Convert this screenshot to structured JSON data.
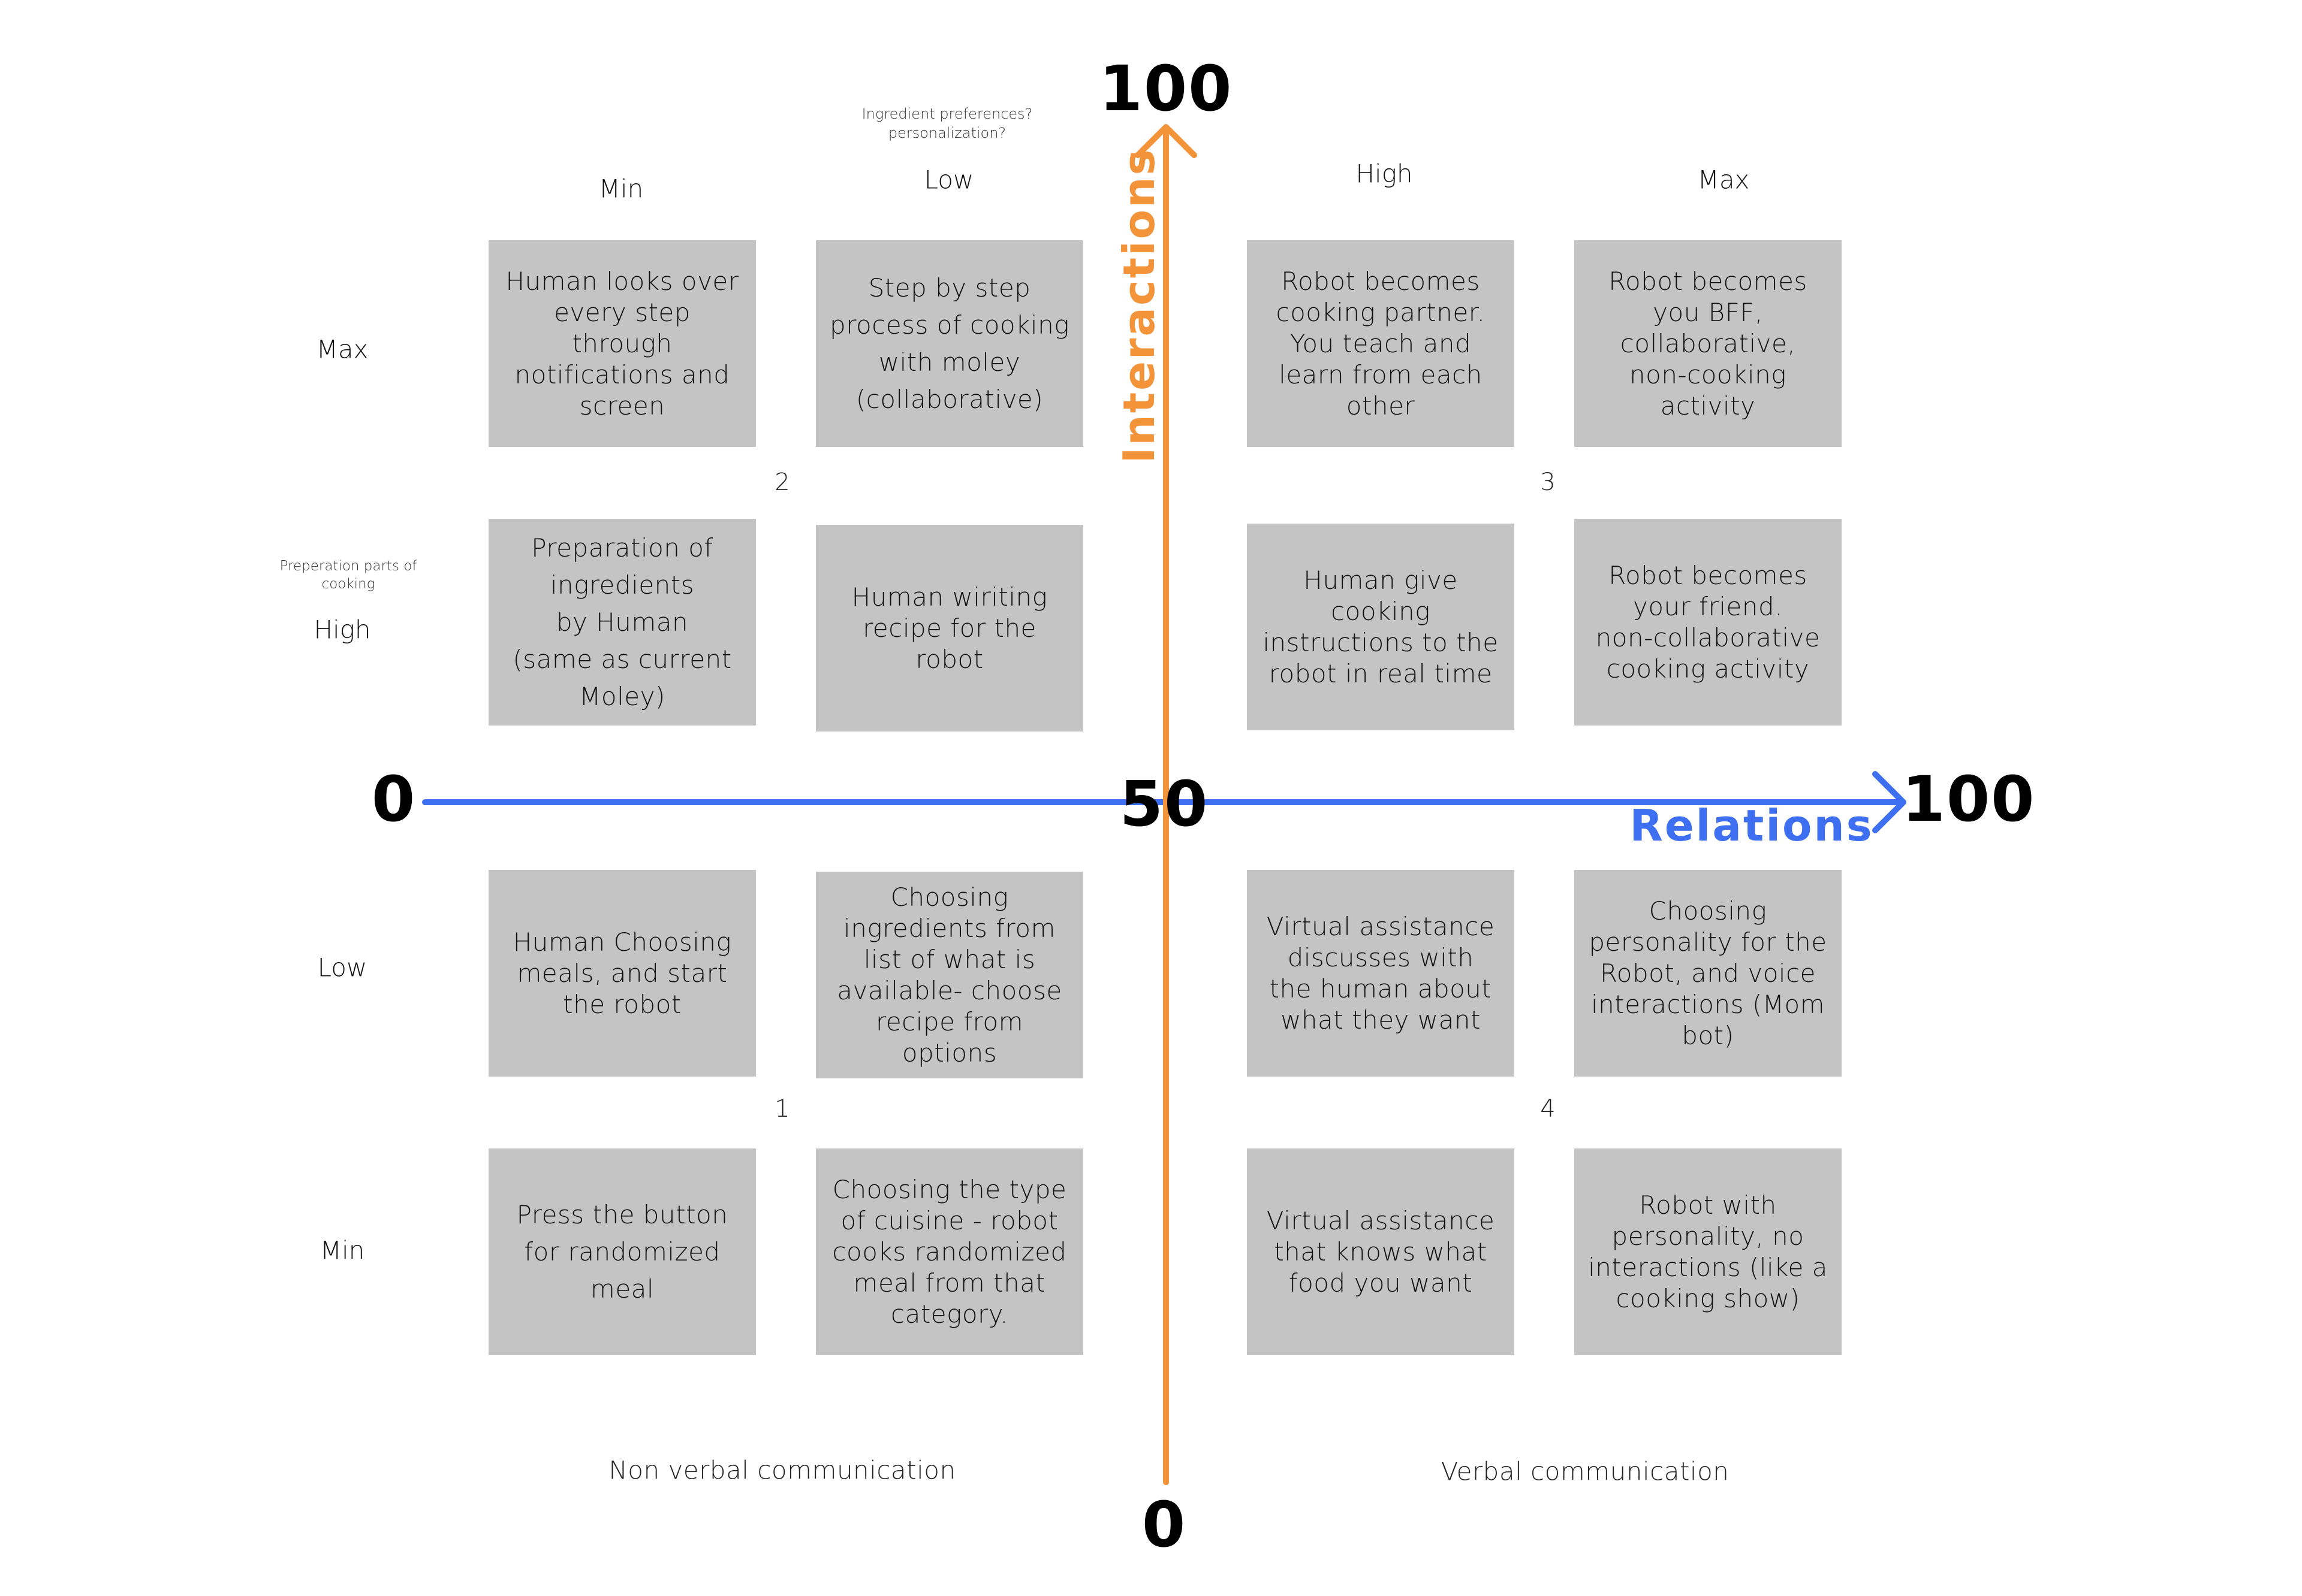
{
  "colors": {
    "relations_axis": "#3d6ff0",
    "interactions_axis": "#f4943a",
    "card_fill": "#c4c4c4",
    "background": "#ffffff"
  },
  "axes": {
    "horizontal": {
      "name": "Relations",
      "min_label": "0",
      "max_label": "100"
    },
    "vertical": {
      "name": "Interactions",
      "min_label": "0",
      "max_label": "100"
    },
    "center_label": "50"
  },
  "column_labels": [
    "Min",
    "Low",
    "High",
    "Max"
  ],
  "row_labels": [
    "Max",
    "High",
    "Low",
    "Min"
  ],
  "notes": {
    "column_low_note": [
      "Ingredient preferences?",
      "personalization?"
    ],
    "row_high_note": [
      "Preperation parts of",
      "cooking"
    ]
  },
  "quadrant_numbers": {
    "top_left": "2",
    "top_right": "3",
    "bottom_left": "1",
    "bottom_right": "4"
  },
  "bottom_labels": {
    "left": "Non verbal communication",
    "right": "Verbal communication"
  },
  "cards": [
    [
      "Human looks over every step through notifications and screen",
      "Step by step process of cooking with moley (collaborative)",
      "Robot becomes cooking partner. You teach and learn from each other",
      "Robot becomes you BFF, collaborative, non-cooking activity"
    ],
    [
      "Preparation of ingredients by Human (same as current Moley)",
      "Human wiriting recipe for the robot",
      "Human give cooking instructions to the robot in real time",
      "Robot becomes your friend. non-collaborative cooking activity"
    ],
    [
      "Human Choosing meals, and start the robot",
      "Choosing ingredients from list of what is available- choose recipe from options",
      "Virtual assistance discusses with the human about what they want",
      "Choosing personality for the Robot, and voice interactions (Mom bot)"
    ],
    [
      "Press the button for randomized meal",
      "Choosing the type of cuisine - robot cooks randomized meal from that category.",
      "Virtual assistance that knows what food you want",
      "Robot with personality, no interactions (like a cooking show)"
    ]
  ],
  "card_lines": [
    [
      [
        "Human looks over",
        "every step",
        "through",
        "notifications and",
        "screen"
      ],
      [
        "Step by step",
        "process of cooking",
        "with moley",
        "(collaborative)"
      ],
      [
        "Robot becomes",
        "cooking partner.",
        "You teach and",
        "learn from each",
        "other"
      ],
      [
        "Robot becomes",
        "you BFF,",
        "collaborative,",
        "non-cooking",
        "activity"
      ]
    ],
    [
      [
        "Preparation of",
        "ingredients",
        "by Human",
        "(same as current",
        "Moley)"
      ],
      [
        "Human wiriting",
        "recipe for the robot"
      ],
      [
        "Human give",
        "cooking",
        "instructions to the",
        "robot in real time"
      ],
      [
        "Robot becomes",
        "your friend.",
        "non-collaborative",
        "cooking activity"
      ]
    ],
    [
      [
        "Human Choosing",
        "meals, and start",
        "the robot"
      ],
      [
        "Choosing",
        "ingredients from",
        "list of what is",
        "available- choose",
        "recipe from",
        "options"
      ],
      [
        "Virtual assistance",
        "discusses with",
        "the human about",
        "what they want"
      ],
      [
        "Choosing",
        "personality for the",
        "Robot, and voice",
        "interactions (Mom",
        "bot)"
      ]
    ],
    [
      [
        "Press the button",
        "for randomized",
        "meal"
      ],
      [
        "Choosing the type",
        "of cuisine - robot",
        "cooks randomized",
        "meal from that",
        "category."
      ],
      [
        "Virtual assistance",
        "that knows what",
        "food you want"
      ],
      [
        "Robot with",
        "personality, no",
        "interactions (like a",
        "cooking show)"
      ]
    ]
  ]
}
